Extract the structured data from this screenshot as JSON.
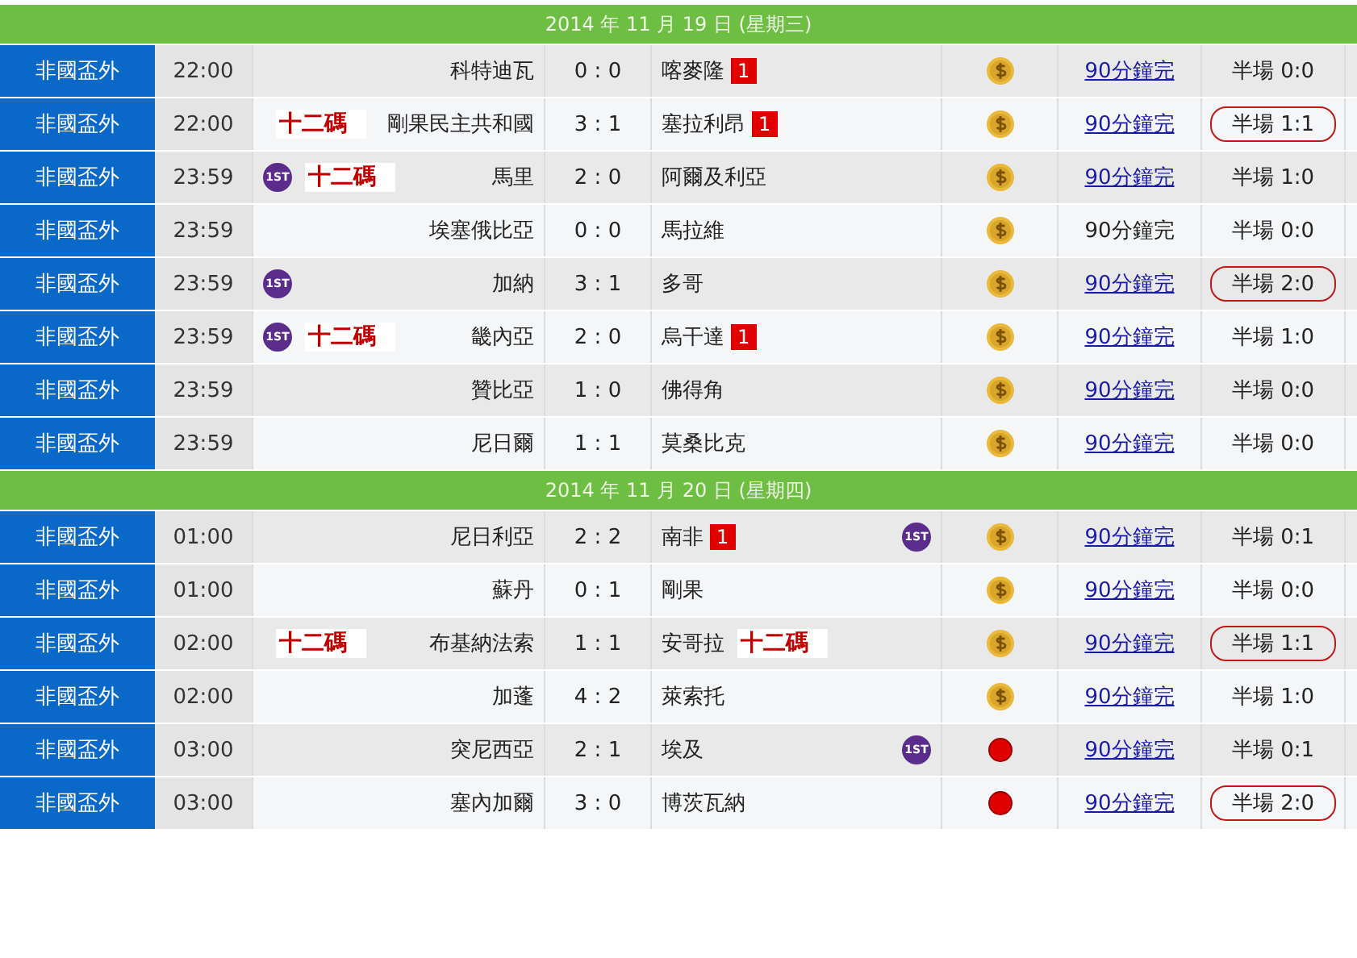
{
  "days": [
    {
      "date": "2014 年 11 月 19 日 (星期三)",
      "matches": [
        {
          "league": "非國盃外",
          "time": "22:00",
          "home": "科特迪瓦",
          "score": "0 : 0",
          "away": "喀麥隆",
          "away_card": "1",
          "kind": "coin",
          "status": "90分鐘完",
          "status_link": true,
          "half": "半場 0:0",
          "half_circled": false
        },
        {
          "league": "非國盃外",
          "time": "22:00",
          "home": "剛果民主共和國",
          "home_note": "十二碼",
          "score": "3 : 1",
          "away": "塞拉利昂",
          "away_card": "1",
          "kind": "coin",
          "status": "90分鐘完",
          "status_link": true,
          "half": "半場 1:1",
          "half_circled": true
        },
        {
          "league": "非國盃外",
          "time": "23:59",
          "home_badge": "1ST",
          "home": "馬里",
          "home_note": "十二碼",
          "score": "2 : 0",
          "away": "阿爾及利亞",
          "kind": "coin",
          "status": "90分鐘完",
          "status_link": true,
          "half": "半場 1:0",
          "half_circled": false
        },
        {
          "league": "非國盃外",
          "time": "23:59",
          "home": "埃塞俄比亞",
          "score": "0 : 0",
          "away": "馬拉維",
          "kind": "coin",
          "status": "90分鐘完",
          "status_link": false,
          "half": "半場 0:0",
          "half_circled": false
        },
        {
          "league": "非國盃外",
          "time": "23:59",
          "home_badge": "1ST",
          "home": "加納",
          "score": "3 : 1",
          "away": "多哥",
          "kind": "coin",
          "status": "90分鐘完",
          "status_link": true,
          "half": "半場 2:0",
          "half_circled": true
        },
        {
          "league": "非國盃外",
          "time": "23:59",
          "home_badge": "1ST",
          "home": "畿內亞",
          "home_note": "十二碼",
          "score": "2 : 0",
          "away": "烏干達",
          "away_card": "1",
          "kind": "coin",
          "status": "90分鐘完",
          "status_link": true,
          "half": "半場 1:0",
          "half_circled": false
        },
        {
          "league": "非國盃外",
          "time": "23:59",
          "home": "贊比亞",
          "score": "1 : 0",
          "away": "佛得角",
          "kind": "coin",
          "status": "90分鐘完",
          "status_link": true,
          "half": "半場 0:0",
          "half_circled": false
        },
        {
          "league": "非國盃外",
          "time": "23:59",
          "home": "尼日爾",
          "score": "1 : 1",
          "away": "莫桑比克",
          "kind": "coin",
          "status": "90分鐘完",
          "status_link": true,
          "half": "半場 0:0",
          "half_circled": false
        }
      ]
    },
    {
      "date": "2014 年 11 月 20 日 (星期四)",
      "matches": [
        {
          "league": "非國盃外",
          "time": "01:00",
          "home": "尼日利亞",
          "score": "2 : 2",
          "away": "南非",
          "away_card": "1",
          "away_badge": "1ST",
          "kind": "coin",
          "status": "90分鐘完",
          "status_link": true,
          "half": "半場 0:1",
          "half_circled": false
        },
        {
          "league": "非國盃外",
          "time": "01:00",
          "home": "蘇丹",
          "score": "0 : 1",
          "away": "剛果",
          "kind": "coin",
          "status": "90分鐘完",
          "status_link": true,
          "half": "半場 0:0",
          "half_circled": false
        },
        {
          "league": "非國盃外",
          "time": "02:00",
          "home": "布基納法索",
          "home_note": "十二碼",
          "score": "1 : 1",
          "away": "安哥拉",
          "away_note": "十二碼",
          "kind": "coin",
          "status": "90分鐘完",
          "status_link": true,
          "half": "半場 1:1",
          "half_circled": true
        },
        {
          "league": "非國盃外",
          "time": "02:00",
          "home": "加蓬",
          "score": "4 : 2",
          "away": "萊索托",
          "kind": "coin",
          "status": "90分鐘完",
          "status_link": true,
          "half": "半場 1:0",
          "half_circled": false
        },
        {
          "league": "非國盃外",
          "time": "03:00",
          "home": "突尼西亞",
          "score": "2 : 1",
          "away": "埃及",
          "away_badge": "1ST",
          "kind": "dot",
          "status": "90分鐘完",
          "status_link": true,
          "half": "半場 0:1",
          "half_circled": false
        },
        {
          "league": "非國盃外",
          "time": "03:00",
          "home": "塞內加爾",
          "score": "3 : 0",
          "away": "博茨瓦納",
          "kind": "dot",
          "status": "90分鐘完",
          "status_link": true,
          "half": "半場 2:0",
          "half_circled": true
        }
      ]
    }
  ]
}
